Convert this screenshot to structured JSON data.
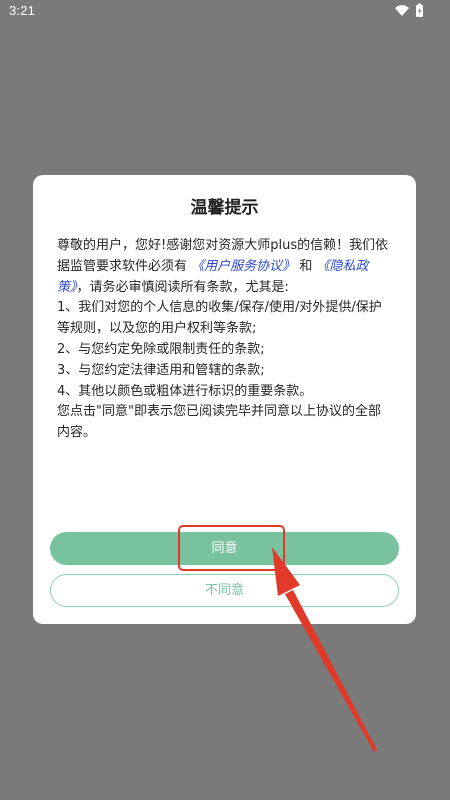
{
  "status_bar": {
    "time": "3:21",
    "icons": [
      "wifi-icon",
      "battery-icon"
    ]
  },
  "dialog": {
    "title": "温馨提示",
    "intro_before_links": "尊敬的用户，您好!感谢您对资源大师plus的信赖！我们依据监管要求软件必须有",
    "link_user_agreement": "《用户服务协议》",
    "connector_and": "和",
    "link_privacy_policy": "《隐私政策》",
    "intro_after_links": "，请务必审慎阅读所有条款，尤其是:",
    "items": [
      "1、我们对您的个人信息的收集/保存/使用/对外提供/保护等规则，以及您的用户权利等条款;",
      "2、与您约定免除或限制责任的条款;",
      "3、与您约定法律适用和管辖的条款;",
      "4、其他以颜色或粗体进行标识的重要条款。"
    ],
    "closing": "您点击\"同意\"即表示您已阅读完毕并同意以上协议的全部内容。",
    "agree_label": "同意",
    "disagree_label": "不同意"
  },
  "colors": {
    "backdrop": "#7a7a7a",
    "accent_green": "#78c2a0",
    "link_blue": "#2b47d0",
    "annotation_red": "#e23a2a"
  }
}
